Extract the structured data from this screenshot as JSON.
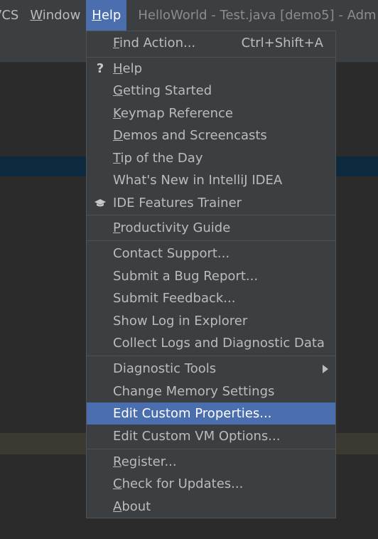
{
  "menubar": {
    "vcs": "VCS",
    "window": "Window",
    "help": "Help",
    "title": "HelloWorld - Test.java [demo5] - Adm"
  },
  "help_menu": {
    "find_action": {
      "label": "Find Action...",
      "shortcut": "Ctrl+Shift+A"
    },
    "help": "Help",
    "getting_started": "Getting Started",
    "keymap_reference": "Keymap Reference",
    "demos": "Demos and Screencasts",
    "tip": "Tip of the Day",
    "whats_new": "What's New in IntelliJ IDEA",
    "ide_trainer": "IDE Features Trainer",
    "productivity": "Productivity Guide",
    "contact_support": "Contact Support...",
    "submit_bug": "Submit a Bug Report...",
    "submit_feedback": "Submit Feedback...",
    "show_log": "Show Log in Explorer",
    "collect_logs": "Collect Logs and Diagnostic Data",
    "diagnostic_tools": "Diagnostic Tools",
    "change_memory": "Change Memory Settings",
    "edit_props": "Edit Custom Properties...",
    "edit_vm": "Edit Custom VM Options...",
    "register": "Register...",
    "check_updates": "Check for Updates...",
    "about": "About"
  },
  "icons": {
    "help": "question-mark-icon",
    "trainer": "graduation-cap-icon",
    "submenu": "chevron-right-icon"
  },
  "colors": {
    "selection": "#4b6eaf",
    "menu_bg": "#3c3f41",
    "text": "#bbbbbb"
  }
}
